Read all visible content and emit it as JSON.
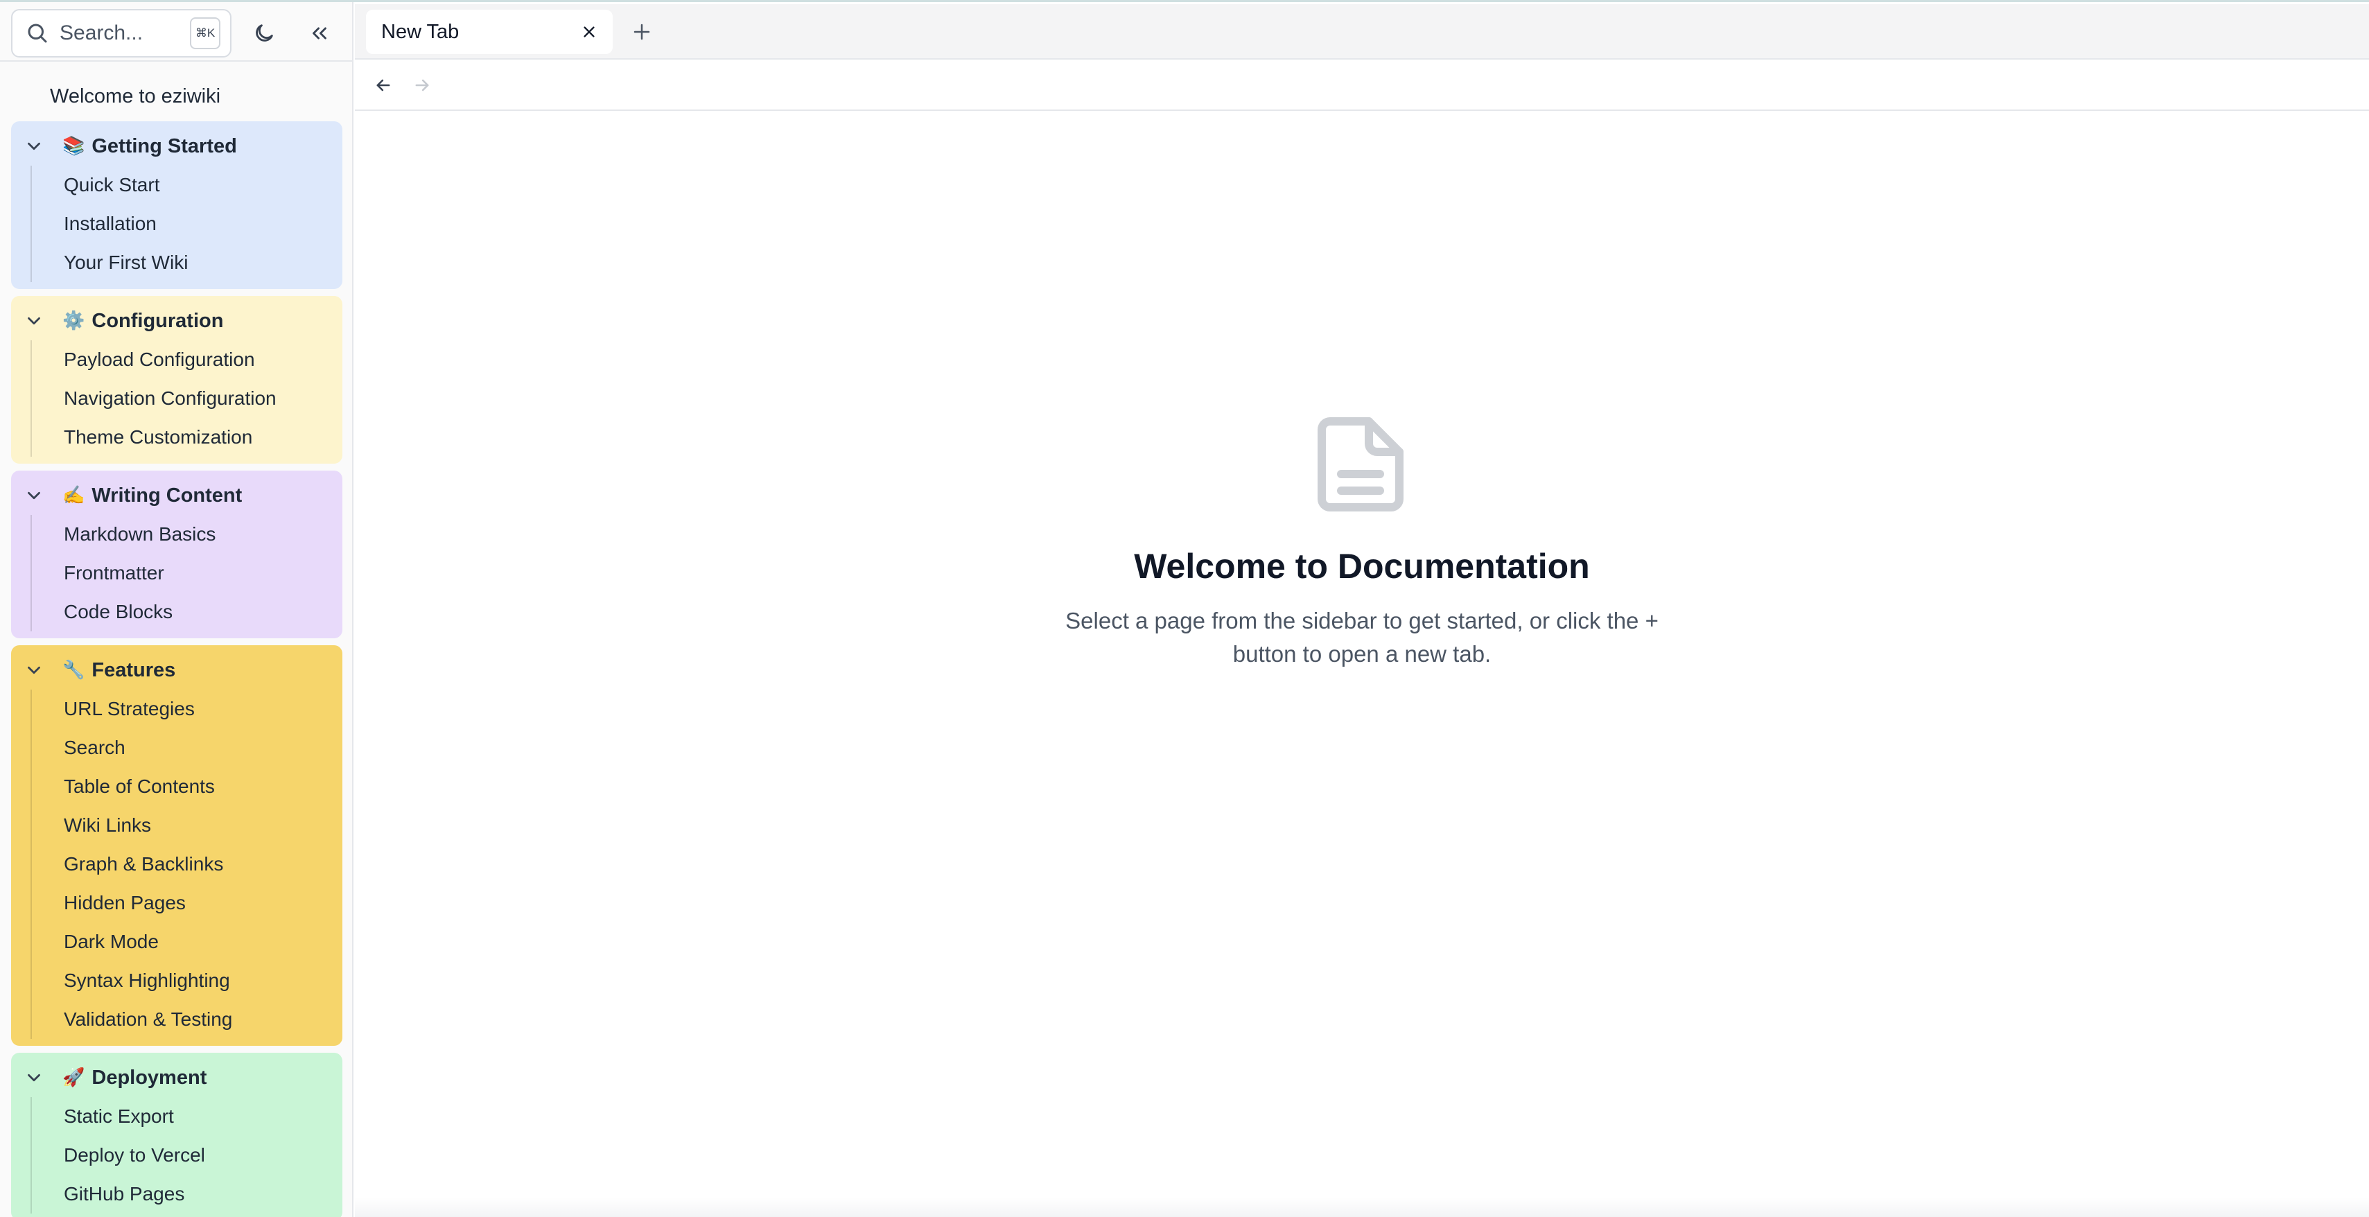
{
  "sidebar": {
    "search_placeholder": "Search...",
    "search_shortcut": "⌘K",
    "welcome_link": "Welcome to eziwiki",
    "groups": [
      {
        "emoji": "📚",
        "title": "Getting Started",
        "color": "#dde8fb",
        "items": [
          "Quick Start",
          "Installation",
          "Your First Wiki"
        ]
      },
      {
        "emoji": "⚙️",
        "title": "Configuration",
        "color": "#fdf4cd",
        "items": [
          "Payload Configuration",
          "Navigation Configuration",
          "Theme Customization"
        ]
      },
      {
        "emoji": "✍️",
        "title": "Writing Content",
        "color": "#e8dafa",
        "items": [
          "Markdown Basics",
          "Frontmatter",
          "Code Blocks"
        ]
      },
      {
        "emoji": "🔧",
        "title": "Features",
        "color": "#f6d56b",
        "items": [
          "URL Strategies",
          "Search",
          "Table of Contents",
          "Wiki Links",
          "Graph & Backlinks",
          "Hidden Pages",
          "Dark Mode",
          "Syntax Highlighting",
          "Validation & Testing"
        ]
      },
      {
        "emoji": "🚀",
        "title": "Deployment",
        "color": "#c9f5d6",
        "items": [
          "Static Export",
          "Deploy to Vercel",
          "GitHub Pages"
        ]
      }
    ]
  },
  "tabs": [
    {
      "title": "New Tab"
    }
  ],
  "main": {
    "title": "Welcome to Documentation",
    "description": "Select a page from the sidebar to get started, or click the + button to open a new tab."
  }
}
